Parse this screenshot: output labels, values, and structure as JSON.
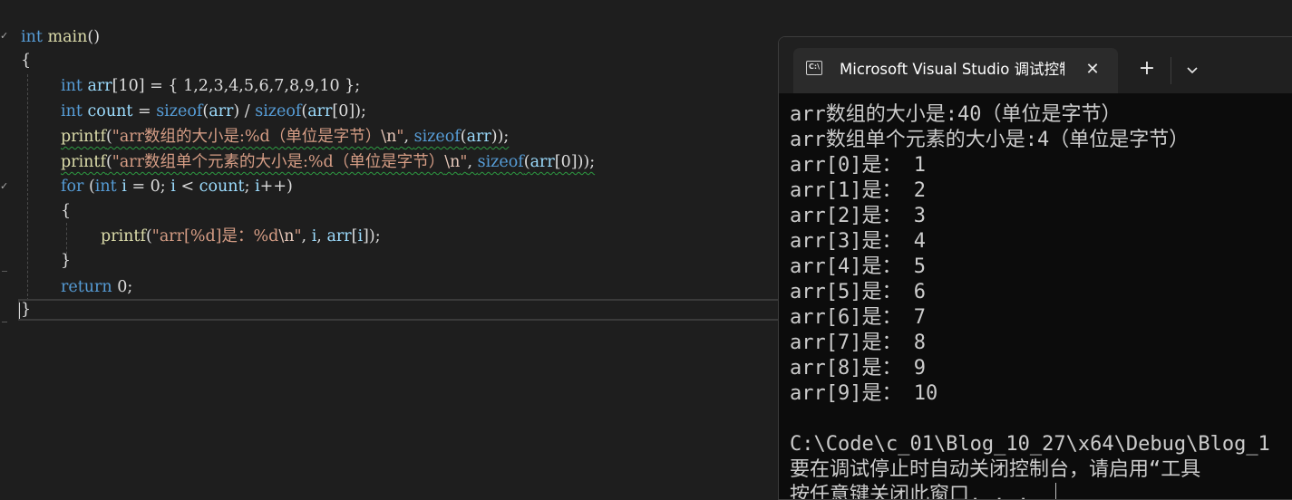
{
  "editor": {
    "lines": [
      [
        [
          "kw",
          "int"
        ],
        [
          "pl",
          " "
        ],
        [
          "fn",
          "main"
        ],
        [
          "pl",
          "()"
        ]
      ],
      [
        [
          "pl",
          "{"
        ]
      ],
      [],
      [
        [
          "kw",
          "int"
        ],
        [
          "pl",
          " "
        ],
        [
          "var",
          "arr"
        ],
        [
          "pl",
          "[10] = { 1,2,3,4,5,6,7,8,9,10 };"
        ]
      ],
      [
        [
          "kw",
          "int"
        ],
        [
          "pl",
          " "
        ],
        [
          "var",
          "count"
        ],
        [
          "pl",
          " = "
        ],
        [
          "kw",
          "sizeof"
        ],
        [
          "pl",
          "("
        ],
        [
          "var",
          "arr"
        ],
        [
          "pl",
          ") / "
        ],
        [
          "kw",
          "sizeof"
        ],
        [
          "pl",
          "("
        ],
        [
          "var",
          "arr"
        ],
        [
          "pl",
          "[0]);"
        ]
      ],
      [
        [
          "fn",
          "printf"
        ],
        [
          "pl",
          "("
        ],
        [
          "str",
          "\"arr数组的大小是:%d（单位是字节）"
        ],
        [
          "esc",
          "\\n"
        ],
        [
          "str",
          "\""
        ],
        [
          "pl",
          ", "
        ],
        [
          "kw",
          "sizeof"
        ],
        [
          "pl",
          "("
        ],
        [
          "var",
          "arr"
        ],
        [
          "pl",
          "));"
        ]
      ],
      [
        [
          "fn",
          "printf"
        ],
        [
          "pl",
          "("
        ],
        [
          "str",
          "\"arr数组单个元素的大小是:%d（单位是字节）"
        ],
        [
          "esc",
          "\\n"
        ],
        [
          "str",
          "\""
        ],
        [
          "pl",
          ", "
        ],
        [
          "kw",
          "sizeof"
        ],
        [
          "pl",
          "("
        ],
        [
          "var",
          "arr"
        ],
        [
          "pl",
          "[0]));"
        ]
      ],
      [
        [
          "kw",
          "for"
        ],
        [
          "pl",
          " ("
        ],
        [
          "kw",
          "int"
        ],
        [
          "pl",
          " "
        ],
        [
          "var",
          "i"
        ],
        [
          "pl",
          " = 0; "
        ],
        [
          "var",
          "i"
        ],
        [
          "pl",
          " < "
        ],
        [
          "var",
          "count"
        ],
        [
          "pl",
          "; "
        ],
        [
          "var",
          "i"
        ],
        [
          "pl",
          "++)"
        ]
      ],
      [
        [
          "pl",
          "{"
        ]
      ],
      [
        [
          "fn",
          "printf"
        ],
        [
          "pl",
          "("
        ],
        [
          "str",
          "\"arr[%d]是：%d"
        ],
        [
          "esc",
          "\\n"
        ],
        [
          "str",
          "\""
        ],
        [
          "pl",
          ", "
        ],
        [
          "var",
          "i"
        ],
        [
          "pl",
          ", "
        ],
        [
          "var",
          "arr"
        ],
        [
          "pl",
          "["
        ],
        [
          "var",
          "i"
        ],
        [
          "pl",
          "]);"
        ]
      ],
      [
        [
          "pl",
          "}"
        ]
      ],
      [
        [
          "kw",
          "return"
        ],
        [
          "pl",
          " 0;"
        ]
      ],
      [
        [
          "pl",
          "}"
        ]
      ]
    ],
    "fold_marker": "✓"
  },
  "console": {
    "tab_title": "Microsoft Visual Studio 调试控制台",
    "tab_icon_text": "C:\\",
    "close_icon": "✕",
    "new_tab_icon": "+",
    "output": [
      "arr数组的大小是:40（单位是字节）",
      "arr数组单个元素的大小是:4（单位是字节）",
      "arr[0]是： 1",
      "arr[1]是： 2",
      "arr[2]是： 3",
      "arr[3]是： 4",
      "arr[4]是： 5",
      "arr[5]是： 6",
      "arr[6]是： 7",
      "arr[7]是： 8",
      "arr[8]是： 9",
      "arr[9]是： 10",
      "",
      "C:\\Code\\c_01\\Blog_10_27\\x64\\Debug\\Blog_1",
      "要在调试停止时自动关闭控制台，请启用“工具",
      "按任意键关闭此窗口. . ."
    ]
  }
}
